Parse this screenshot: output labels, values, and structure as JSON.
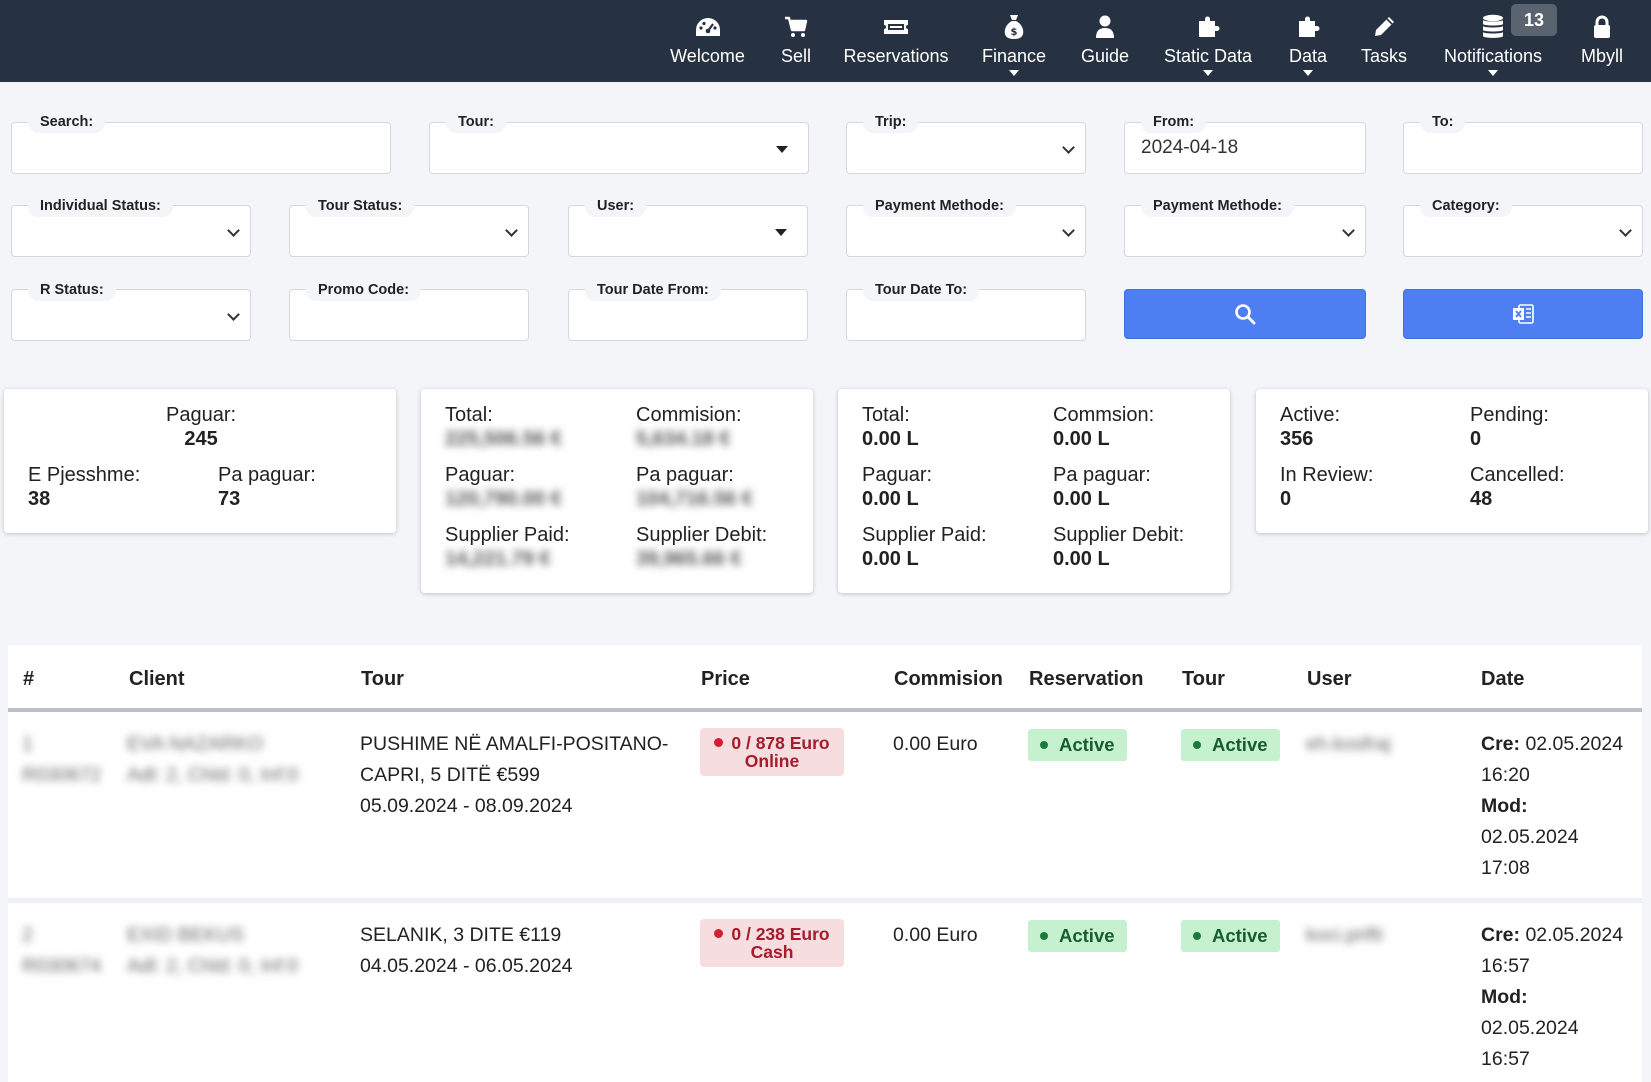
{
  "nav": {
    "items": [
      {
        "label": "Welcome",
        "icon": "dashboard-icon"
      },
      {
        "label": "Sell",
        "icon": "cart-icon"
      },
      {
        "label": "Reservations",
        "icon": "ticket-icon"
      },
      {
        "label": "Finance",
        "icon": "money-bag-icon"
      },
      {
        "label": "Guide",
        "icon": "user-icon"
      },
      {
        "label": "Static Data",
        "icon": "puzzle-icon"
      },
      {
        "label": "Data",
        "icon": "puzzle-icon"
      },
      {
        "label": "Tasks",
        "icon": "pencil-icon"
      },
      {
        "label": "Notifications",
        "icon": "database-icon"
      },
      {
        "label": "Mbyll",
        "icon": "lock-icon"
      }
    ],
    "notifications_count": "13"
  },
  "filters": {
    "search": {
      "label": "Search:",
      "value": ""
    },
    "tour": {
      "label": "Tour:",
      "value": ""
    },
    "trip": {
      "label": "Trip:",
      "value": ""
    },
    "from": {
      "label": "From:",
      "value": "2024-04-18"
    },
    "to": {
      "label": "To:",
      "value": ""
    },
    "individual_status": {
      "label": "Individual Status:",
      "value": ""
    },
    "tour_status": {
      "label": "Tour Status:",
      "value": ""
    },
    "user": {
      "label": "User:",
      "value": ""
    },
    "payment_method_1": {
      "label": "Payment Methode:",
      "value": ""
    },
    "payment_method_2": {
      "label": "Payment Methode:",
      "value": ""
    },
    "category": {
      "label": "Category:",
      "value": ""
    },
    "r_status": {
      "label": "R Status:",
      "value": ""
    },
    "promo_code": {
      "label": "Promo Code:",
      "value": ""
    },
    "tour_date_from": {
      "label": "Tour Date From:",
      "value": ""
    },
    "tour_date_to": {
      "label": "Tour Date To:",
      "value": ""
    }
  },
  "cards": {
    "counts": {
      "paguar_label": "Paguar:",
      "paguar_value": "245",
      "pjesshme_label": "E Pjesshme:",
      "pjesshme_value": "38",
      "papaguar_label": "Pa paguar:",
      "papaguar_value": "73"
    },
    "euro": {
      "total_label": "Total:",
      "total_value": "225,506.56 €",
      "commission_label": "Commision:",
      "commission_value": "5,634.18 €",
      "paguar_label": "Paguar:",
      "paguar_value": "120,790.00 €",
      "papaguar_label": "Pa paguar:",
      "papaguar_value": "104,716.56 €",
      "supplier_paid_label": "Supplier Paid:",
      "supplier_paid_value": "14,221.79 €",
      "supplier_debit_label": "Supplier Debit:",
      "supplier_debit_value": "39,965.66 €"
    },
    "lek": {
      "total_label": "Total:",
      "total_value": "0.00 L",
      "commission_label": "Commsion:",
      "commission_value": "0.00 L",
      "paguar_label": "Paguar:",
      "paguar_value": "0.00 L",
      "papaguar_label": "Pa paguar:",
      "papaguar_value": "0.00 L",
      "supplier_paid_label": "Supplier Paid:",
      "supplier_paid_value": "0.00 L",
      "supplier_debit_label": "Supplier Debit:",
      "supplier_debit_value": "0.00 L"
    },
    "status": {
      "active_label": "Active:",
      "active_value": "356",
      "pending_label": "Pending:",
      "pending_value": "0",
      "review_label": "In Review:",
      "review_value": "0",
      "cancelled_label": "Cancelled:",
      "cancelled_value": "48"
    }
  },
  "table": {
    "headers": [
      "#",
      "Client",
      "Tour",
      "Price",
      "Commision",
      "Reservation",
      "Tour",
      "User",
      "Date"
    ],
    "rows": [
      {
        "num": "1",
        "code": "R030672",
        "client_name": "EVA NAZARKO",
        "client_detail": "Adl: 2, Chld: 0, Inf:0",
        "tour_line1": "PUSHIME NË AMALFI-POSITANO-",
        "tour_line2": "CAPRI, 5 DITË €599",
        "tour_dates": "05.09.2024 - 08.09.2024",
        "price_line1": "0 / 878 Euro",
        "price_line2": "Online",
        "commission": "0.00 Euro",
        "reservation_status": "Active",
        "tour_status": "Active",
        "user": "eh.kosfraj",
        "created_label": "Cre:",
        "created_date": "02.05.2024",
        "created_time": "16:20",
        "modified_label": "Mod:",
        "modified_date": "02.05.2024",
        "modified_time": "17:08"
      },
      {
        "num": "2",
        "code": "R030674",
        "client_name": "EXID BEKUS",
        "client_detail": "Adl: 2, Chld: 0, Inf:0",
        "tour_line1": "SELANIK, 3 DITE €119",
        "tour_line2": "04.05.2024 - 06.05.2024",
        "price_line1": "0 / 238 Euro",
        "price_line2": "Cash",
        "commission": "0.00 Euro",
        "reservation_status": "Active",
        "tour_status": "Active",
        "user": "koci.prifti",
        "created_label": "Cre:",
        "created_date": "02.05.2024",
        "created_time": "16:57",
        "modified_label": "Mod:",
        "modified_date": "02.05.2024",
        "modified_time": "16:57"
      }
    ]
  }
}
